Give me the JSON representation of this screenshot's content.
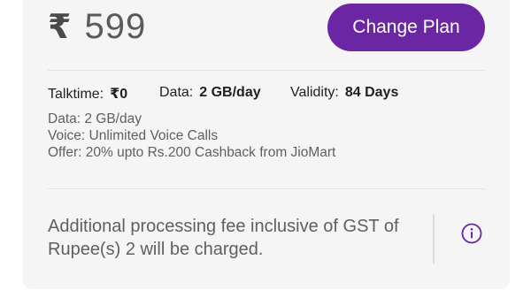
{
  "plan": {
    "currency_symbol": "₹",
    "price": "599",
    "change_label": "Change Plan"
  },
  "summary": {
    "talktime_label": "Talktime:",
    "talktime_value": "₹0",
    "data_label": "Data:",
    "data_value": "2 GB/day",
    "validity_label": "Validity:",
    "validity_value": "84 Days"
  },
  "details": [
    "Data: 2 GB/day",
    "Voice: Unlimited Voice Calls",
    "Offer: 20% upto Rs.200 Cashback from JioMart"
  ],
  "notice": {
    "text": "Additional processing fee inclusive of GST of Rupee(s) 2 will be charged.",
    "icon": "info-icon"
  },
  "colors": {
    "accent": "#6a26a3",
    "card_bg": "#f5f5f5"
  }
}
